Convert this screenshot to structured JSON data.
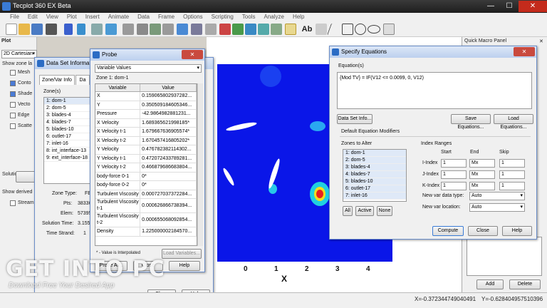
{
  "app": {
    "title": "Tecplot 360 EX Beta"
  },
  "window_controls": {
    "minimize": "—",
    "maximize": "☐",
    "close": "✕"
  },
  "menu": [
    "File",
    "Edit",
    "View",
    "Plot",
    "Insert",
    "Animate",
    "Data",
    "Frame",
    "Options",
    "Scripting",
    "Tools",
    "Analyze",
    "Help"
  ],
  "toolbar": {
    "text_label": "Ab"
  },
  "left_panel": {
    "header": "Plot",
    "plot_type": "2D Cartesian",
    "show_zone_label": "Show zone la",
    "layers": [
      "Mesh",
      "Conto",
      "Shade",
      "Vecto",
      "Edge",
      "Scatte"
    ],
    "solution_time_label": "Solution time:",
    "show_derived": "Show derived",
    "stream": "Stream"
  },
  "quick_macro": {
    "title": "Quick Macro Panel",
    "close": "✕",
    "add_label": "Add",
    "delete_label": "Delete"
  },
  "axis": {
    "ticks": [
      "0",
      "1",
      "2",
      "3",
      "4"
    ],
    "xlabel": "X"
  },
  "dataset_info": {
    "title": "Data Set Information",
    "tabs": [
      "Zone/Var Info",
      "Da"
    ],
    "zones_label": "Zone(s)",
    "zones": [
      "1: dom-1",
      "2: dom-5",
      "3: blades-4",
      "4: blades-7",
      "5: blades-10",
      "6: outlet-17",
      "7: inlet-16",
      "8: int_interface-13",
      "9: ext_interface-18"
    ],
    "zone_type_label": "Zone Type:",
    "zone_type_value": "FE - Q",
    "pts_label": "Pts:",
    "pts_value": "38336",
    "elem_label": "Elem:",
    "elem_value": "57395",
    "solution_time_label": "Solution Time:",
    "solution_time_value": "3.155",
    "time_strand_label": "Time Strand:",
    "time_strand_value": "1",
    "close_label": "Close",
    "help_label": "Help"
  },
  "probe": {
    "title": "Probe",
    "dropdown": "Variable Values",
    "zone_label": "Zone 1: dom-1",
    "col_variable": "Variable",
    "col_value": "Value",
    "rows": [
      {
        "name": "X",
        "value": "0.159065802937282..."
      },
      {
        "name": "Y",
        "value": "0.350509184605346..."
      },
      {
        "name": "Pressure",
        "value": "-42.9864982881231..."
      },
      {
        "name": "X Velocity",
        "value": "1.689365621998185*"
      },
      {
        "name": "X Velocity t-1",
        "value": "1.679667636905574*"
      },
      {
        "name": "X Velocity t-2",
        "value": "1.670457416805202*"
      },
      {
        "name": "Y Velocity",
        "value": "0.476782382114302..."
      },
      {
        "name": "Y Velocity t-1",
        "value": "0.472072433789281..."
      },
      {
        "name": "Y Velocity t-2",
        "value": "0.466879686683804..."
      },
      {
        "name": "body-force 0-1",
        "value": "0*"
      },
      {
        "name": "body-force 0-2",
        "value": "0*"
      },
      {
        "name": "Turbulent Viscosity",
        "value": "0.000727037372284..."
      },
      {
        "name": "Turbulent Viscosity t-1",
        "value": "0.000626866738394..."
      },
      {
        "name": "Turbulent Viscosity t-2",
        "value": "0.000655068092854..."
      },
      {
        "name": "Density",
        "value": "1.225000002184570..."
      }
    ],
    "footnote": "* - Value is Interpolated",
    "load_vars_label": "Load Variables...",
    "probe_at_label": "Probe At...",
    "close_label": "Close",
    "help_label": "Help",
    "close_x": "✕"
  },
  "equations": {
    "title": "Specify Equations",
    "close_x": "✕",
    "equations_label": "Equation(s)",
    "equation_text": "{Mod TV} = IF(V12 <= 0.0099, 0, V12)",
    "dataset_info_label": "Data Set Info...",
    "save_label": "Save Equations...",
    "load_label": "Load Equations...",
    "modifiers_label": "Default Equation Modifiers",
    "zones_alter_label": "Zones to Alter",
    "zones": [
      "1: dom-1",
      "2: dom-5",
      "3: blades-4",
      "4: blades-7",
      "5: blades-10",
      "6: outlet-17",
      "7: inlet-16"
    ],
    "all_label": "All",
    "active_label": "Active",
    "none_label": "None",
    "index_ranges_label": "Index Ranges",
    "col_start": "Start",
    "col_end": "End",
    "col_skip": "Skip",
    "i_index": "I-Index",
    "j_index": "J-Index",
    "k_index": "K-Index",
    "start_val": "1",
    "end_val": "Mx",
    "skip_val": "1",
    "new_var_type_label": "New var data type:",
    "new_var_type_value": "Auto",
    "new_var_loc_label": "New var location:",
    "new_var_loc_value": "Auto",
    "compute_label": "Compute",
    "close_label": "Close",
    "help_label": "Help"
  },
  "status": {
    "x_coord": "X=-0.372344749040491",
    "y_coord": "Y=-0.628404957510396"
  },
  "watermark": {
    "main": "GET INTO PC",
    "sub": "Download Free Your Desired App"
  }
}
